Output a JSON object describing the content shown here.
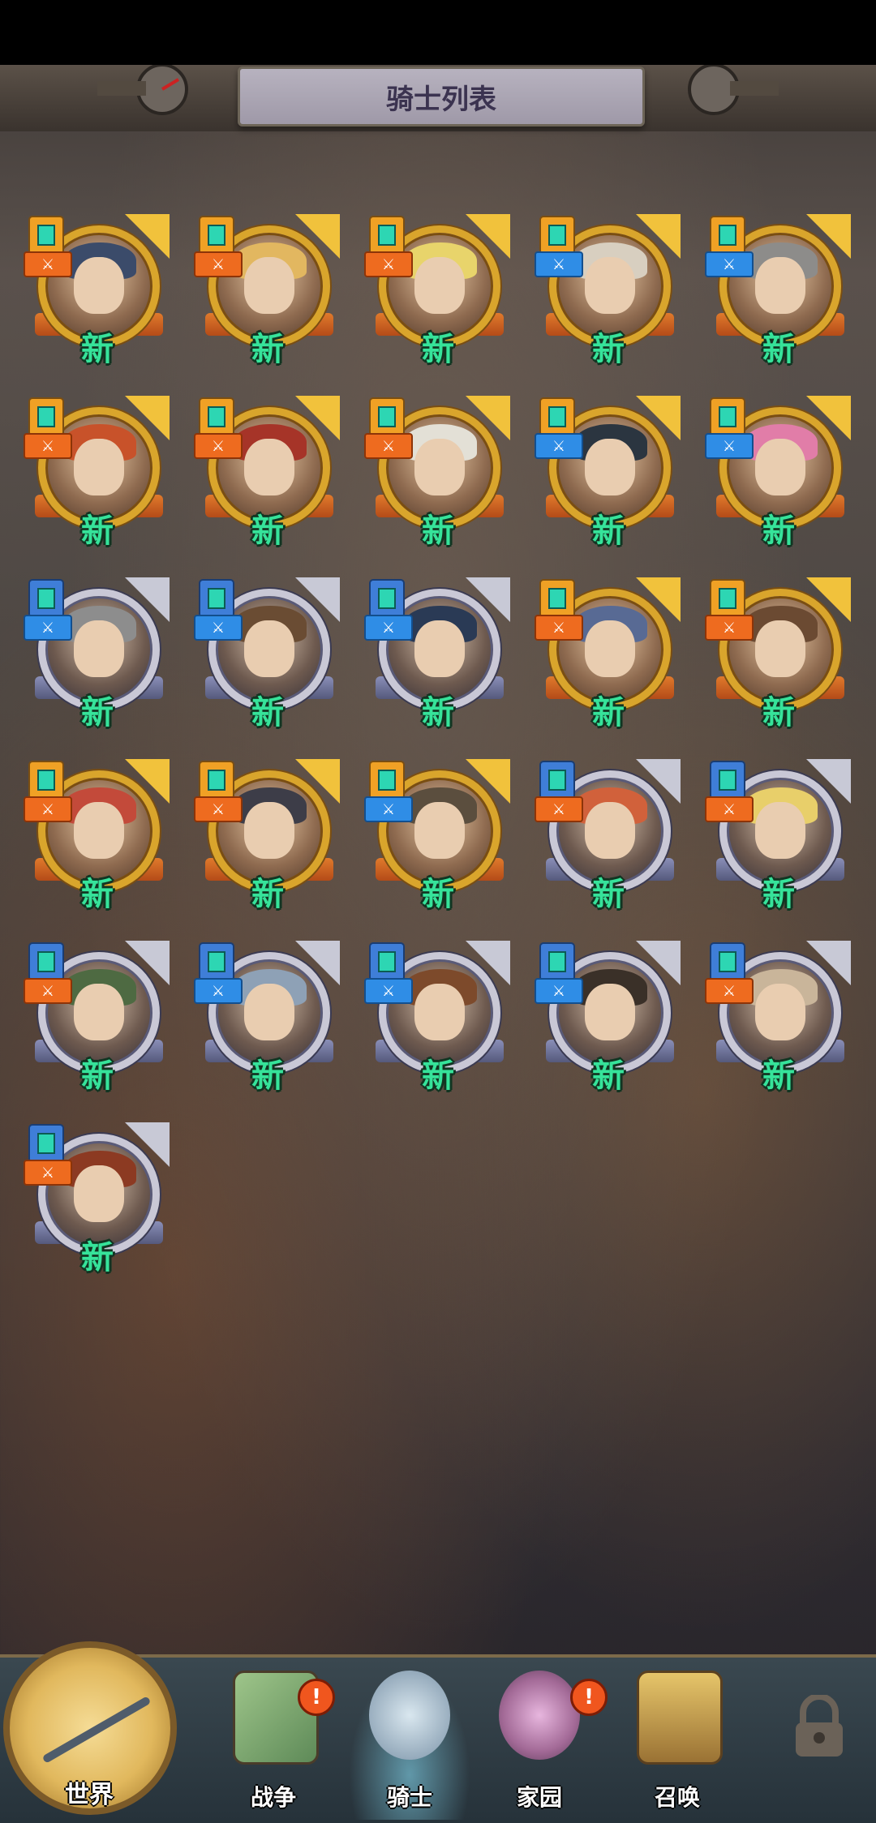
{
  "header": {
    "title": "骑士列表"
  },
  "knights": [
    {
      "frame": "gold",
      "type": "orange",
      "role": "orange",
      "label": "新",
      "hair": "#3b4b6a"
    },
    {
      "frame": "gold",
      "type": "orange",
      "role": "orange",
      "label": "新",
      "hair": "#e2b760"
    },
    {
      "frame": "gold",
      "type": "orange",
      "role": "orange",
      "label": "新",
      "hair": "#e8d46b"
    },
    {
      "frame": "gold",
      "type": "orange",
      "role": "blue",
      "label": "新",
      "hair": "#d8cfc0"
    },
    {
      "frame": "gold",
      "type": "orange",
      "role": "blue",
      "label": "新",
      "hair": "#8d8c8a"
    },
    {
      "frame": "gold",
      "type": "orange",
      "role": "orange",
      "label": "新",
      "hair": "#c8522a"
    },
    {
      "frame": "gold",
      "type": "orange",
      "role": "orange",
      "label": "新",
      "hair": "#a63428"
    },
    {
      "frame": "gold",
      "type": "orange",
      "role": "orange",
      "label": "新",
      "hair": "#e3e0d6"
    },
    {
      "frame": "gold",
      "type": "orange",
      "role": "blue",
      "label": "新",
      "hair": "#2b3540"
    },
    {
      "frame": "gold",
      "type": "orange",
      "role": "blue",
      "label": "新",
      "hair": "#e17da8"
    },
    {
      "frame": "silver",
      "type": "blue",
      "role": "blue",
      "label": "新",
      "hair": "#8d8d8d"
    },
    {
      "frame": "silver",
      "type": "blue",
      "role": "blue",
      "label": "新",
      "hair": "#6a4c33"
    },
    {
      "frame": "silver",
      "type": "blue",
      "role": "blue",
      "label": "新",
      "hair": "#2a3a55"
    },
    {
      "frame": "gold",
      "type": "orange",
      "role": "orange",
      "label": "新",
      "hair": "#586a94"
    },
    {
      "frame": "gold",
      "type": "orange",
      "role": "orange",
      "label": "新",
      "hair": "#6b4a32"
    },
    {
      "frame": "gold",
      "type": "orange",
      "role": "orange",
      "label": "新",
      "hair": "#c34a3a"
    },
    {
      "frame": "gold",
      "type": "orange",
      "role": "orange",
      "label": "新",
      "hair": "#3d3d48"
    },
    {
      "frame": "gold",
      "type": "orange",
      "role": "blue",
      "label": "新",
      "hair": "#5b4e3e"
    },
    {
      "frame": "silver",
      "type": "blue",
      "role": "orange",
      "label": "新",
      "hair": "#d1613b"
    },
    {
      "frame": "silver",
      "type": "blue",
      "role": "orange",
      "label": "新",
      "hair": "#e8cf6a"
    },
    {
      "frame": "silver",
      "type": "blue",
      "role": "orange",
      "label": "新",
      "hair": "#4e6a42"
    },
    {
      "frame": "silver",
      "type": "blue",
      "role": "blue",
      "label": "新",
      "hair": "#8ea1b6"
    },
    {
      "frame": "silver",
      "type": "blue",
      "role": "blue",
      "label": "新",
      "hair": "#7d4a2b"
    },
    {
      "frame": "silver",
      "type": "blue",
      "role": "blue",
      "label": "新",
      "hair": "#3a3028"
    },
    {
      "frame": "silver",
      "type": "blue",
      "role": "orange",
      "label": "新",
      "hair": "#c9b59a"
    },
    {
      "frame": "silver",
      "type": "blue",
      "role": "orange",
      "label": "新",
      "hair": "#8c3a22"
    }
  ],
  "nav": {
    "world": "世界",
    "war": "战争",
    "knight": "骑士",
    "home": "家园",
    "summon": "召唤",
    "alert_symbol": "!"
  }
}
